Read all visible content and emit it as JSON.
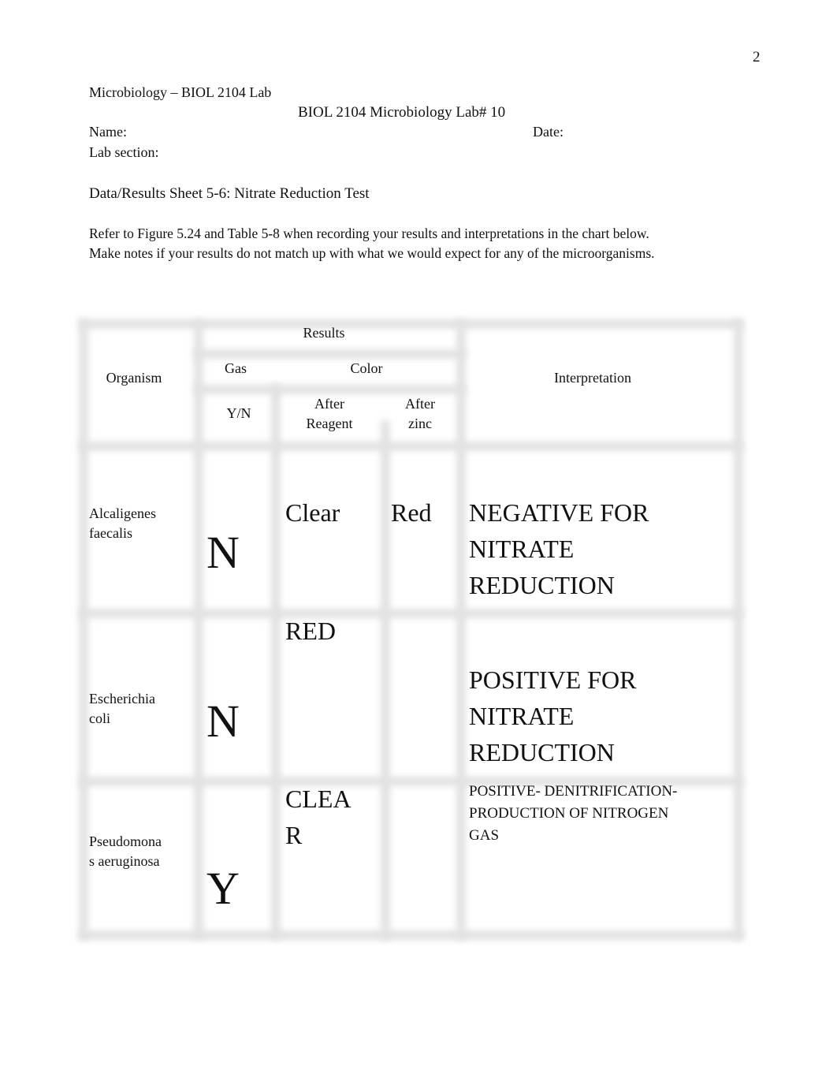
{
  "page_number": "2",
  "header": {
    "course_line": "Microbiology – BIOL 2104 Lab",
    "lab_title": "BIOL 2104 Microbiology Lab# 10",
    "name_label": "Name:",
    "date_label": "Date:",
    "lab_section_label": "Lab section:"
  },
  "sheet_title": "Data/Results Sheet 5-6: Nitrate Reduction Test",
  "instructions": "Refer to Figure 5.24 and Table 5-8 when recording your results and interpretations in the chart below. Make notes if your results do not match up with what we would expect for any of the microorganisms.",
  "table": {
    "headers": {
      "organism": "Organism",
      "results": "Results",
      "gas": "Gas",
      "color": "Color",
      "yn": "Y/N",
      "after_reagent_1": "After",
      "after_reagent_2": "Reagent",
      "after_zinc_1": "After",
      "after_zinc_2": "zinc",
      "interpretation": "Interpretation"
    },
    "rows": [
      {
        "organism_1": "Alcaligenes",
        "organism_2": "faecalis",
        "gas": "N",
        "after_reagent_1": "Clear",
        "after_reagent_2": "",
        "after_zinc": "Red",
        "interpretation_1": "NEGATIVE FOR",
        "interpretation_2": "NITRATE",
        "interpretation_3": "REDUCTION"
      },
      {
        "organism_1": "Escherichia",
        "organism_2": "coli",
        "gas": "N",
        "after_reagent_1": "RED",
        "after_reagent_2": "",
        "after_zinc": "",
        "interpretation_1": "POSITIVE FOR",
        "interpretation_2": "NITRATE",
        "interpretation_3": "REDUCTION"
      },
      {
        "organism_1": "Pseudomona",
        "organism_2": "s aeruginosa",
        "gas": "Y",
        "after_reagent_1": "CLEA",
        "after_reagent_2": "R",
        "after_zinc": "",
        "interpretation_1": "POSITIVE- DENITRIFICATION-",
        "interpretation_2": "PRODUCTION OF NITROGEN",
        "interpretation_3": "GAS"
      }
    ]
  }
}
